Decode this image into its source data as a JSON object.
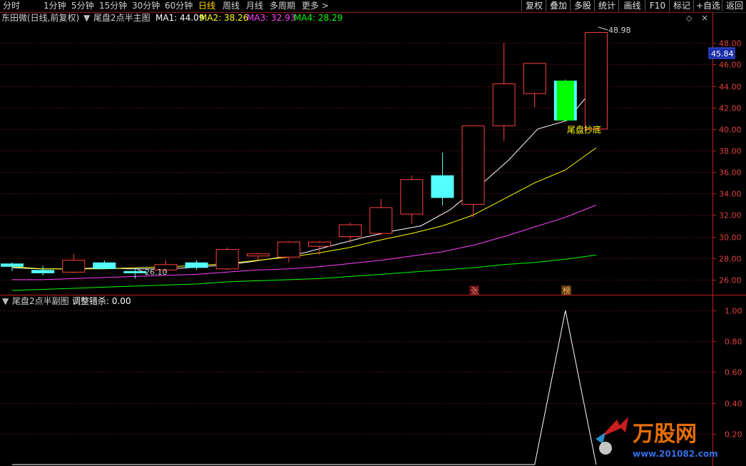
{
  "toolbar": {
    "periods": [
      "分时",
      "1分钟",
      "5分钟",
      "15分钟",
      "30分钟",
      "60分钟",
      "日线",
      "周线",
      "月线",
      "多周期",
      "更多 >"
    ],
    "active_period": "日线",
    "buttons": [
      "复权",
      "叠加",
      "多股",
      "统计",
      "画线",
      "F10",
      "标记",
      "+自选",
      "返回"
    ]
  },
  "main_chart": {
    "stock_title": "东田微(日线,前复权)",
    "indicator_name": "尾盘2点半主图",
    "ma_values": [
      {
        "label": "MA1: 44.09",
        "color": "#ffffff"
      },
      {
        "label": "MA2: 38.26",
        "color": "#ffff00"
      },
      {
        "label": "MA3: 32.93",
        "color": "#ff40ff"
      },
      {
        "label": "MA4: 28.29",
        "color": "#00ff00"
      }
    ],
    "price_labels": [
      "48.00",
      "46.00",
      "44.00",
      "42.00",
      "40.00",
      "38.00",
      "36.00",
      "34.00",
      "32.00",
      "30.00",
      "28.00",
      "26.00"
    ],
    "current_price": "45.84",
    "high_annotation": "48.98",
    "low_annotation": "26.10",
    "signal_label": "尾盘抄底",
    "markers": [
      "张",
      "榜"
    ],
    "colors": {
      "up": "#ff4040",
      "down": "#54ffff",
      "signal": "#00ff00",
      "grid": "#8b1a1a",
      "axis": "#c02020"
    }
  },
  "sub_chart": {
    "indicator_name": "尾盘2点半副图",
    "param_label": "调整错杀: 0.00",
    "value_labels": [
      "1.00",
      "0.80",
      "0.60",
      "0.40",
      "0.20"
    ]
  },
  "chart_data": {
    "type": "candlestick",
    "y_range": [
      24.6,
      50.8
    ],
    "candles": [
      {
        "o": 27.2,
        "h": 27.6,
        "l": 26.8,
        "c": 27.5,
        "up": false
      },
      {
        "o": 26.9,
        "h": 27.3,
        "l": 26.4,
        "c": 26.6,
        "up": false
      },
      {
        "o": 26.7,
        "h": 28.4,
        "l": 26.6,
        "c": 27.8,
        "up": true
      },
      {
        "o": 27.6,
        "h": 27.8,
        "l": 27.0,
        "c": 27.0,
        "up": false
      },
      {
        "o": 26.8,
        "h": 27.0,
        "l": 26.1,
        "c": 26.6,
        "up": false
      },
      {
        "o": 26.9,
        "h": 27.8,
        "l": 26.7,
        "c": 27.4,
        "up": true
      },
      {
        "o": 27.1,
        "h": 27.8,
        "l": 26.9,
        "c": 27.6,
        "up": false
      },
      {
        "o": 27.0,
        "h": 29.0,
        "l": 26.9,
        "c": 28.8,
        "up": true
      },
      {
        "o": 28.2,
        "h": 28.5,
        "l": 27.8,
        "c": 28.4,
        "up": true
      },
      {
        "o": 28.1,
        "h": 29.6,
        "l": 27.6,
        "c": 29.5,
        "up": true
      },
      {
        "o": 29.1,
        "h": 29.6,
        "l": 28.3,
        "c": 29.5,
        "up": true
      },
      {
        "o": 30.0,
        "h": 31.3,
        "l": 29.4,
        "c": 31.1,
        "up": true
      },
      {
        "o": 30.3,
        "h": 33.5,
        "l": 30.1,
        "c": 32.7,
        "up": true
      },
      {
        "o": 32.1,
        "h": 35.7,
        "l": 31.2,
        "c": 35.3,
        "up": true
      },
      {
        "o": 35.7,
        "h": 37.8,
        "l": 32.9,
        "c": 33.6,
        "up": false
      },
      {
        "o": 33.0,
        "h": 40.3,
        "l": 31.8,
        "c": 40.3,
        "up": true
      },
      {
        "o": 40.3,
        "h": 48.0,
        "l": 38.9,
        "c": 44.2,
        "up": true
      },
      {
        "o": 43.3,
        "h": 46.1,
        "l": 42.0,
        "c": 46.1,
        "up": true
      },
      {
        "o": 44.5,
        "h": 44.6,
        "l": 40.7,
        "c": 40.8,
        "up": false,
        "signal": true
      },
      {
        "o": 40.0,
        "h": 48.98,
        "l": 40.0,
        "c": 48.98,
        "up": true
      }
    ],
    "ma_series": [
      {
        "name": "MA1",
        "color": "#ffffff",
        "start_index": 0,
        "values": [
          27.1,
          27.0,
          27.0,
          27.1,
          27.0,
          27.0,
          27.1,
          27.3,
          27.6,
          28.0,
          28.5,
          29.2,
          29.9,
          30.5,
          31.0,
          32.5,
          34.7,
          37.1,
          40.0,
          40.8,
          44.09
        ]
      },
      {
        "name": "MA2",
        "color": "#ffff00",
        "start_index": 0,
        "values": [
          27.2,
          27.0,
          27.0,
          27.0,
          27.1,
          27.2,
          27.3,
          27.5,
          27.8,
          28.1,
          28.5,
          29.0,
          29.7,
          30.3,
          31.0,
          32.0,
          33.5,
          35.0,
          36.2,
          38.26
        ]
      },
      {
        "name": "MA3",
        "color": "#ff40ff",
        "start_index": 0,
        "values": [
          26.0,
          26.0,
          26.1,
          26.2,
          26.3,
          26.4,
          26.5,
          26.7,
          26.9,
          27.0,
          27.2,
          27.5,
          27.8,
          28.2,
          28.6,
          29.2,
          30.0,
          30.9,
          31.8,
          32.93
        ]
      },
      {
        "name": "MA4",
        "color": "#00ff00",
        "start_index": 0,
        "values": [
          25.0,
          25.1,
          25.2,
          25.3,
          25.4,
          25.5,
          25.6,
          25.8,
          25.9,
          26.0,
          26.1,
          26.3,
          26.5,
          26.7,
          26.9,
          27.1,
          27.4,
          27.6,
          27.9,
          28.29
        ]
      }
    ],
    "sub_series": {
      "name": "调整错杀",
      "range": [
        0,
        1.0
      ],
      "values": [
        0,
        0,
        0,
        0,
        0,
        0,
        0,
        0,
        0,
        0,
        0,
        0,
        0,
        0,
        0,
        0,
        0,
        0,
        1.0,
        0
      ]
    }
  }
}
